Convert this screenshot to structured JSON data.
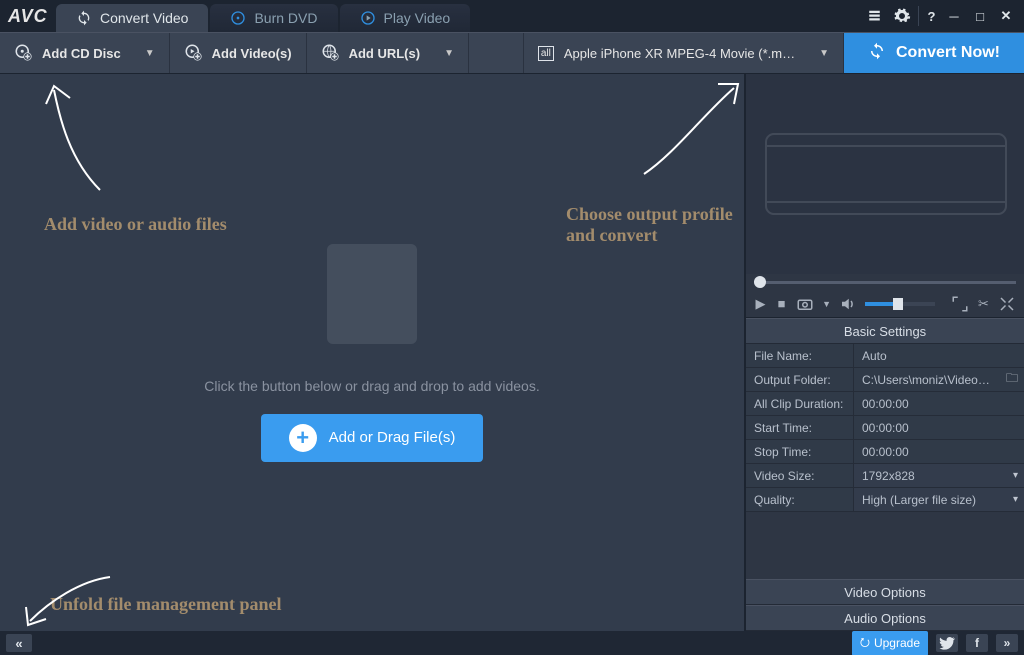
{
  "app": {
    "logo": "AVC"
  },
  "tabs": [
    {
      "label": "Convert Video",
      "icon": "refresh-icon",
      "active": true
    },
    {
      "label": "Burn DVD",
      "icon": "disc-icon",
      "active": false
    },
    {
      "label": "Play Video",
      "icon": "play-icon",
      "active": false
    }
  ],
  "toolbar": {
    "add_cd": "Add CD Disc",
    "add_videos": "Add Video(s)",
    "add_urls": "Add URL(s)",
    "profile": "Apple iPhone XR MPEG-4 Movie (*.m…",
    "convert": "Convert Now!"
  },
  "main": {
    "hint": "Click the button below or drag and drop to add videos.",
    "add_button": "Add or Drag File(s)"
  },
  "settings": {
    "title": "Basic Settings",
    "rows": {
      "file_name": {
        "label": "File Name:",
        "value": "Auto"
      },
      "output_folder": {
        "label": "Output Folder:",
        "value": "C:\\Users\\moniz\\Videos…"
      },
      "all_clip": {
        "label": "All Clip Duration:",
        "value": "00:00:00"
      },
      "start_time": {
        "label": "Start Time:",
        "value": "00:00:00"
      },
      "stop_time": {
        "label": "Stop Time:",
        "value": "00:00:00"
      },
      "video_size": {
        "label": "Video Size:",
        "value": "1792x828"
      },
      "quality": {
        "label": "Quality:",
        "value": "High (Larger file size)"
      }
    },
    "video_options": "Video Options",
    "audio_options": "Audio Options"
  },
  "statusbar": {
    "upgrade": "Upgrade"
  },
  "annotations": {
    "add_files": "Add video or audio files",
    "choose_profile": "Choose output profile and convert",
    "unfold_panel": "Unfold file management panel"
  }
}
